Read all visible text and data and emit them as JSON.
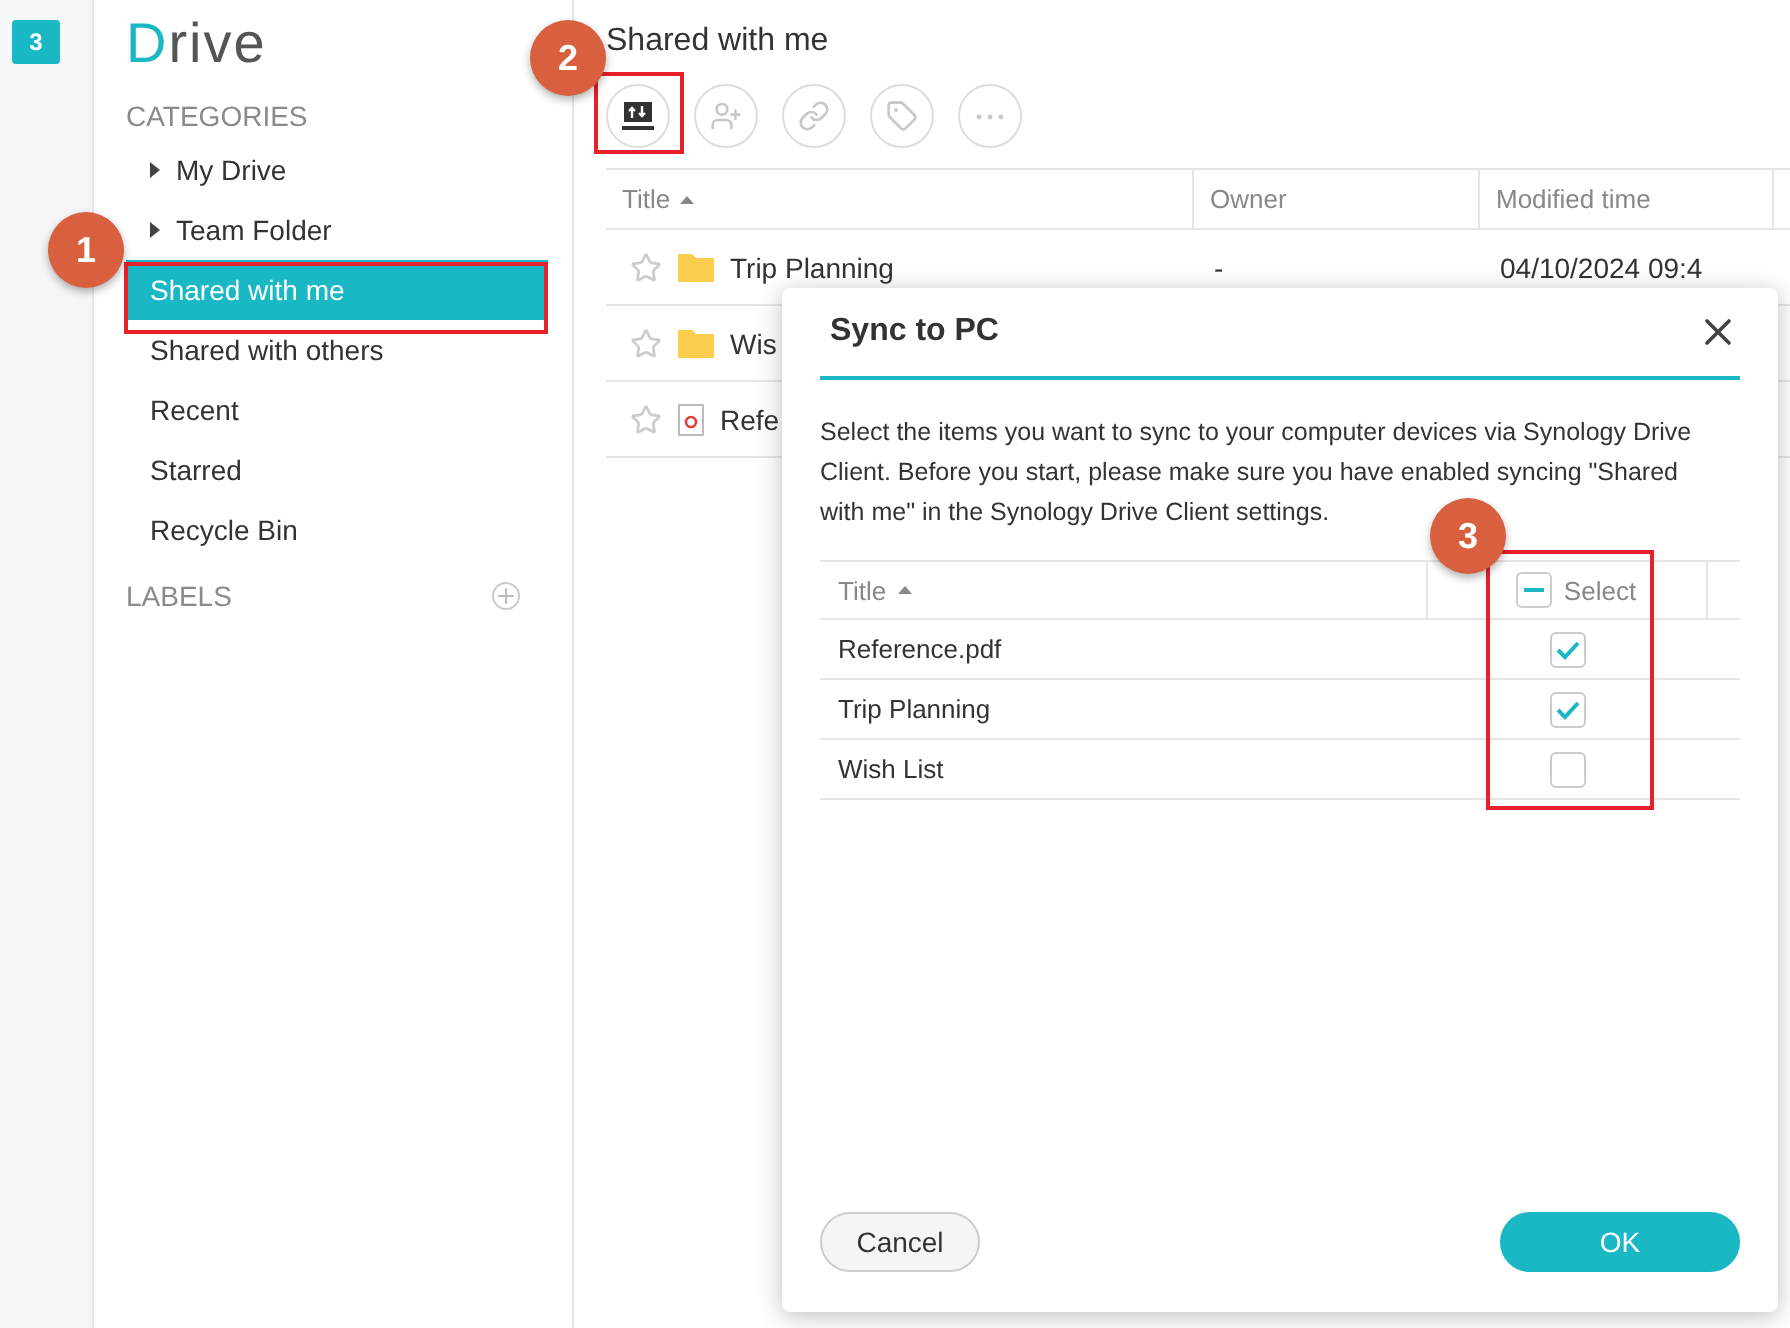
{
  "app_badge": "3",
  "logo": {
    "first": "D",
    "rest": "rive"
  },
  "sidebar": {
    "categories_heading": "CATEGORIES",
    "items": [
      {
        "label": "My Drive",
        "kind": "tree",
        "selected": false
      },
      {
        "label": "Team Folder",
        "kind": "tree",
        "selected": false
      },
      {
        "label": "Shared with me",
        "kind": "plain",
        "selected": true
      },
      {
        "label": "Shared with others",
        "kind": "plain",
        "selected": false
      },
      {
        "label": "Recent",
        "kind": "plain",
        "selected": false
      },
      {
        "label": "Starred",
        "kind": "plain",
        "selected": false
      },
      {
        "label": "Recycle Bin",
        "kind": "plain",
        "selected": false
      }
    ],
    "labels_heading": "LABELS"
  },
  "page_title": "Shared with me",
  "toolbar": [
    {
      "kind": "sync",
      "disabled": false
    },
    {
      "kind": "share",
      "disabled": true
    },
    {
      "kind": "link",
      "disabled": true
    },
    {
      "kind": "tag",
      "disabled": true
    },
    {
      "kind": "more",
      "disabled": true
    }
  ],
  "table": {
    "columns": [
      "Title",
      "Owner",
      "Modified time"
    ],
    "rows": [
      {
        "title": "Trip Planning",
        "kind": "folder",
        "owner": "-",
        "modified": "04/10/2024 09:4"
      },
      {
        "title": "Wis",
        "kind": "folder"
      },
      {
        "title": "Refe",
        "kind": "pdf"
      }
    ]
  },
  "dialog": {
    "title": "Sync to PC",
    "description": "Select the items you want to sync to your computer devices via Synology Drive Client. Before you start, please make sure you have enabled syncing \"Shared with me\" in the Synology Drive Client settings.",
    "columns": [
      "Title",
      "Select"
    ],
    "select_all_indeterminate": true,
    "rows": [
      {
        "title": "Reference.pdf",
        "checked": true
      },
      {
        "title": "Trip Planning",
        "checked": true
      },
      {
        "title": "Wish List",
        "checked": false
      }
    ],
    "buttons": [
      {
        "label": "Cancel",
        "kind": "secondary"
      },
      {
        "label": "OK",
        "kind": "primary"
      }
    ]
  },
  "annotations": [
    "1",
    "2",
    "3"
  ]
}
